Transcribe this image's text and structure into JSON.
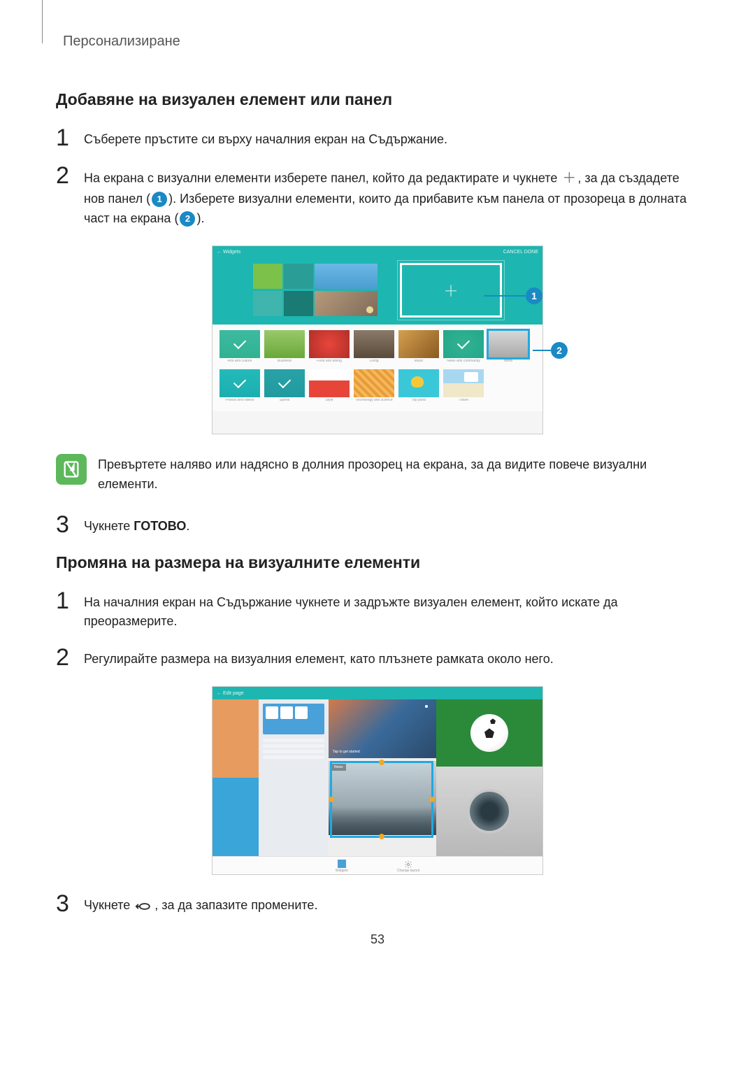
{
  "breadcrumb": "Персонализиране",
  "section1": {
    "title": "Добавяне на визуален елемент или панел",
    "step1": "Съберете пръстите си върху началния екран на Съдържание.",
    "step2_a": "На екрана с визуални елементи изберете панел, който да редактирате и чукнете ",
    "step2_b": ", за да създадете нов панел (",
    "step2_c": "). Изберете визуални елементи, които да прибавите към панела от прозореца в долната част на екрана (",
    "step2_d": ").",
    "step3_a": "Чукнете ",
    "step3_b": "ГОТОВО",
    "step3_c": "."
  },
  "note": "Превъртете наляво или надясно в долния прозорец на екрана, за да видите повече визуални елементи.",
  "section2": {
    "title": "Промяна на размера на визуалните елементи",
    "step1": "На началния екран на Съдържание чукнете и задръжте визуален елемент, който искате да преоразмерите.",
    "step2": "Регулирайте размера на визуалния елемент, като плъзнете рамката около него.",
    "step3_a": "Чукнете ",
    "step3_b": ", за да запазите промените."
  },
  "callouts": {
    "c1": "1",
    "c2": "2"
  },
  "inline_nums": {
    "n1": "1",
    "n2": "2"
  },
  "step_nums": {
    "s1": "1",
    "s2": "2",
    "s3": "3"
  },
  "page_number": "53",
  "screenshot1": {
    "topbar_left": "← Widgets",
    "topbar_right": "CANCEL   DONE"
  },
  "screenshot2": {
    "topbar_left": "← Edit page",
    "bottom_widgets": "Widgets",
    "bottom_layout": "Change layout"
  }
}
